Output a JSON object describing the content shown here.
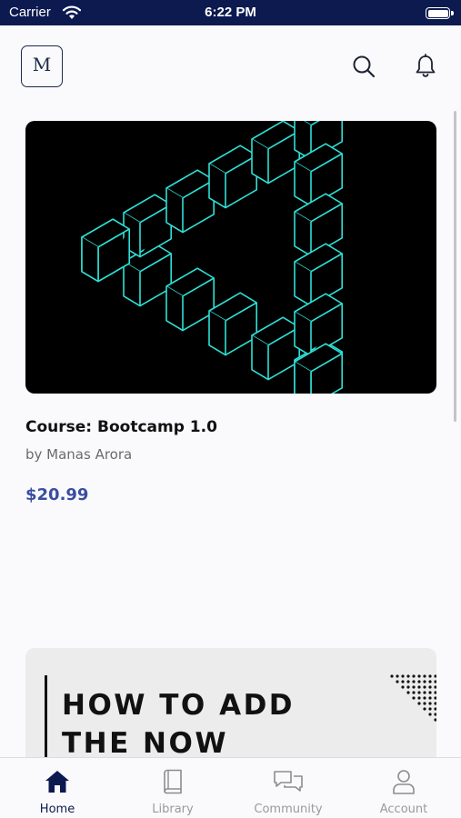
{
  "status_bar": {
    "carrier": "Carrier",
    "time": "6:22 PM"
  },
  "header": {
    "logo_letter": "M"
  },
  "course": {
    "title": "Course: Bootcamp 1.0",
    "author": "by Manas Arora",
    "price": "$20.99"
  },
  "promo": {
    "line1": "HOW TO ADD",
    "line2": "THE NOW"
  },
  "tabs": [
    {
      "label": "Home",
      "icon": "home-icon",
      "active": true
    },
    {
      "label": "Library",
      "icon": "book-icon",
      "active": false
    },
    {
      "label": "Community",
      "icon": "chat-icon",
      "active": false
    },
    {
      "label": "Account",
      "icon": "person-icon",
      "active": false
    }
  ],
  "colors": {
    "status_bar": "#0c1a4f",
    "accent": "#0c1a4f",
    "price": "#3a4ea0",
    "cube_stroke": "#2ee0d6"
  }
}
